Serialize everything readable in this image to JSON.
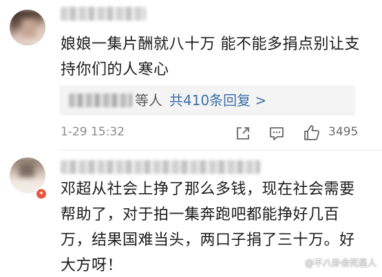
{
  "comments": [
    {
      "text_line1": "娘娘一集片酬就八十万 能不能多捐点别让支",
      "text_line2": "持你们的人寒心",
      "reply_suffix": "等人",
      "reply_link": "共410条回复 >",
      "time": "1-29 15:32",
      "likes": "3495"
    },
    {
      "text_line1": "邓超从社会上挣了那么多钱，现在社会需要",
      "text_line2": "帮助了，对于拍一集奔跑吧都能挣好几百",
      "text_line3": "万，结果国难当头，两口子捐了三十万。好",
      "text_line4": "大方呀！"
    }
  ],
  "watermark": "@不八卦会死星人",
  "colors": {
    "link": "#3d6fa8",
    "meta": "#8a8a8a",
    "reply_bg": "#f4f4f4"
  }
}
